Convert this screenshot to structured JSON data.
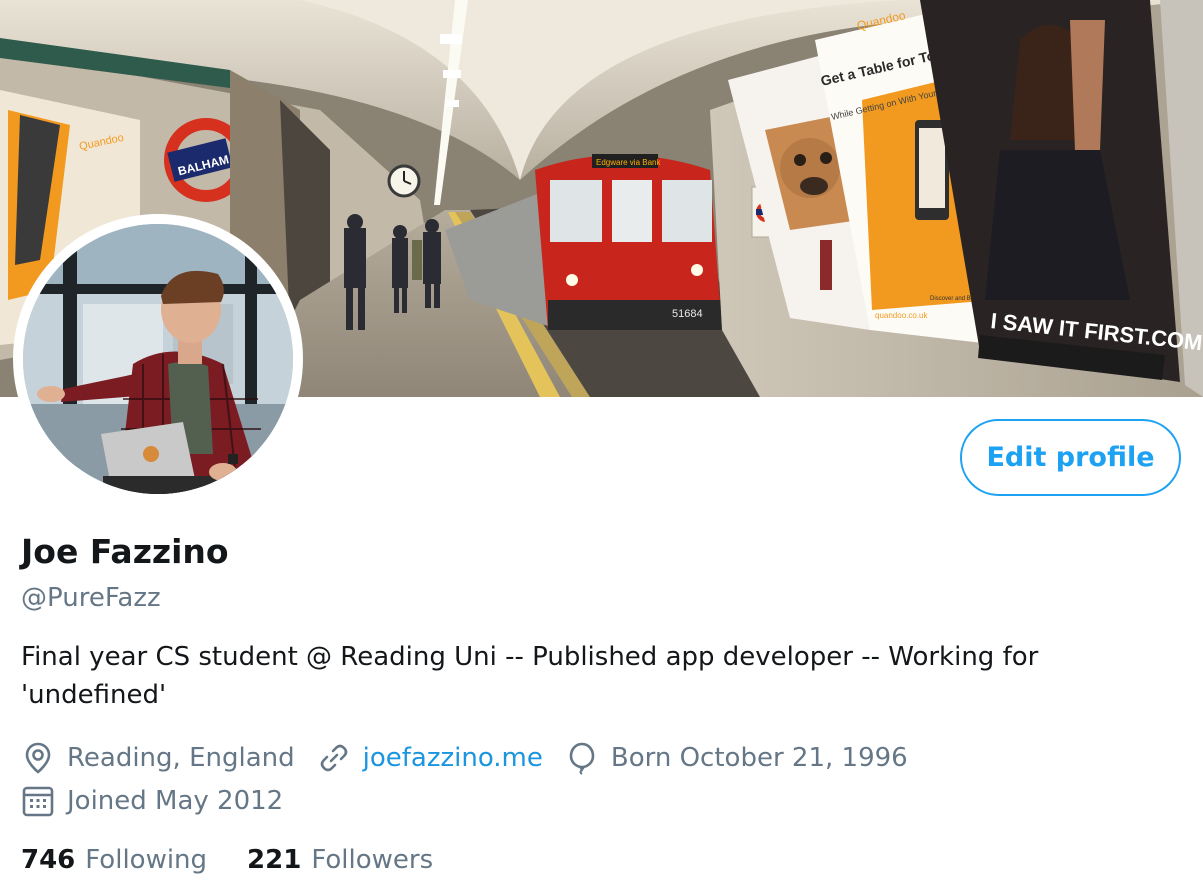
{
  "banner": {
    "station_sign": "BALHAM",
    "ad_brand": "Quandoo",
    "ad_headline": "Get a Table for Tonight",
    "ad_subline": "While Getting on With Your Day!",
    "ad_footer_left": "Discover and Book Restaurants You'll Love",
    "ad_url": "quandoo.co.uk",
    "fashion_ad_text": "I SAW IT FIRST.COM",
    "train_number": "51684",
    "train_destination": "Edgware via Bank",
    "colors": {
      "train_red": "#c8261c",
      "ad_orange": "#f29a1f",
      "tunnel_wall": "#d8d1c4"
    }
  },
  "profile": {
    "display_name": "Joe Fazzino",
    "handle": "@PureFazz",
    "bio": "Final year CS student @ Reading Uni -- Published app developer -- Working for 'undefined'",
    "location": "Reading, England",
    "website": "joefazzino.me",
    "birthday": "Born October 21, 1996",
    "joined": "Joined May 2012",
    "icons": {
      "location": "location-pin-icon",
      "website": "link-icon",
      "birthday": "balloon-icon",
      "joined": "calendar-icon"
    }
  },
  "actions": {
    "edit_profile_label": "Edit profile"
  },
  "stats": {
    "following_count": "746",
    "following_label": "Following",
    "followers_count": "221",
    "followers_label": "Followers"
  },
  "colors": {
    "accent": "#1da1f2",
    "link": "#1b95e0",
    "muted": "#657786",
    "text": "#14171a"
  }
}
